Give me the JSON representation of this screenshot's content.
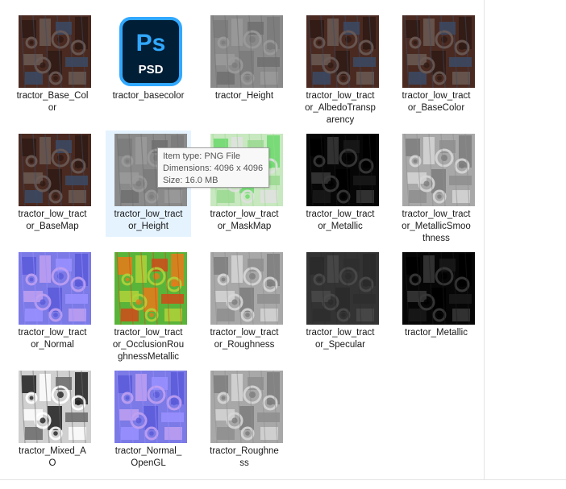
{
  "files": [
    {
      "name": "tractor_Base_Color",
      "label_lines": [
        "tractor_Base_Col",
        "or"
      ],
      "thumb": "color"
    },
    {
      "name": "tractor_basecolor",
      "label_lines": [
        "tractor_basecolor"
      ],
      "thumb": "psd",
      "psd_badge": "Ps",
      "psd_ext": "PSD"
    },
    {
      "name": "tractor_Height",
      "label_lines": [
        "tractor_Height"
      ],
      "thumb": "height"
    },
    {
      "name": "tractor_low_tractor_AlbedoTransparency",
      "label_lines": [
        "tractor_low_tract",
        "or_AlbedoTransp",
        "arency"
      ],
      "thumb": "color"
    },
    {
      "name": "tractor_low_tractor_BaseColor",
      "label_lines": [
        "tractor_low_tract",
        "or_BaseColor"
      ],
      "thumb": "color"
    },
    {
      "name": "tractor_low_tractor_BaseMap",
      "label_lines": [
        "tractor_low_tract",
        "or_BaseMap"
      ],
      "thumb": "color"
    },
    {
      "name": "tractor_low_tractor_Height",
      "label_lines": [
        "tractor_low_tract",
        "or_Height"
      ],
      "thumb": "height",
      "hovered": true
    },
    {
      "name": "tractor_low_tractor_MaskMap",
      "label_lines": [
        "tractor_low_tract",
        "or_MaskMap"
      ],
      "thumb": "mask"
    },
    {
      "name": "tractor_low_tractor_Metallic",
      "label_lines": [
        "tractor_low_tract",
        "or_Metallic"
      ],
      "thumb": "metallic"
    },
    {
      "name": "tractor_low_tractor_MetallicSmoothness",
      "label_lines": [
        "tractor_low_tract",
        "or_MetallicSmoo",
        "thness"
      ],
      "thumb": "grey"
    },
    {
      "name": "tractor_low_tractor_Normal",
      "label_lines": [
        "tractor_low_tract",
        "or_Normal"
      ],
      "thumb": "normal"
    },
    {
      "name": "tractor_low_tractor_OcclusionRoughnessMetallic",
      "label_lines": [
        "tractor_low_tract",
        "or_OcclusionRou",
        "ghnessMetallic"
      ],
      "thumb": "orm"
    },
    {
      "name": "tractor_low_tractor_Roughness",
      "label_lines": [
        "tractor_low_tract",
        "or_Roughness"
      ],
      "thumb": "grey"
    },
    {
      "name": "tractor_low_tractor_Specular",
      "label_lines": [
        "tractor_low_tract",
        "or_Specular"
      ],
      "thumb": "specular"
    },
    {
      "name": "tractor_Metallic",
      "label_lines": [
        "tractor_Metallic"
      ],
      "thumb": "metallic"
    },
    {
      "name": "tractor_Mixed_AO",
      "label_lines": [
        "tractor_Mixed_A",
        "O"
      ],
      "thumb": "ao"
    },
    {
      "name": "tractor_Normal_OpenGL",
      "label_lines": [
        "tractor_Normal_",
        "OpenGL"
      ],
      "thumb": "normal"
    },
    {
      "name": "tractor_Roughness",
      "label_lines": [
        "tractor_Roughne",
        "ss"
      ],
      "thumb": "grey"
    }
  ],
  "tooltip": {
    "item_type": "Item type: PNG File",
    "dimensions": "Dimensions: 4096 x 4096",
    "size": "Size: 16.0 MB"
  },
  "thumb_palettes": {
    "color": {
      "bg": "#4a2a20",
      "a": "#2e1a14",
      "b": "#6a5a55",
      "c": "#3b4a66"
    },
    "height": {
      "bg": "#8a8a8a",
      "a": "#7a7a7a",
      "b": "#9a9a9a",
      "c": "#6e6e6e"
    },
    "mask": {
      "bg": "#c8e8c0",
      "a": "#6ad86a",
      "b": "#e0e0e0",
      "c": "#9ad890"
    },
    "metallic": {
      "bg": "#060606",
      "a": "#000000",
      "b": "#3a3a3a",
      "c": "#1a1a1a"
    },
    "grey": {
      "bg": "#a8a8a8",
      "a": "#7c7c7c",
      "b": "#d6d6d6",
      "c": "#8e8e8e"
    },
    "normal": {
      "bg": "#7b7ae6",
      "a": "#5a5ad8",
      "b": "#c0a0f0",
      "c": "#9a90ff"
    },
    "orm": {
      "bg": "#59b43a",
      "a": "#e87a1a",
      "b": "#b0d23a",
      "c": "#d04a1a"
    },
    "specular": {
      "bg": "#333333",
      "a": "#2a2a2a",
      "b": "#4a4a4a",
      "c": "#2e2e2e"
    },
    "ao": {
      "bg": "#d0d0d0",
      "a": "#202020",
      "b": "#ffffff",
      "c": "#6a6a6a"
    }
  }
}
